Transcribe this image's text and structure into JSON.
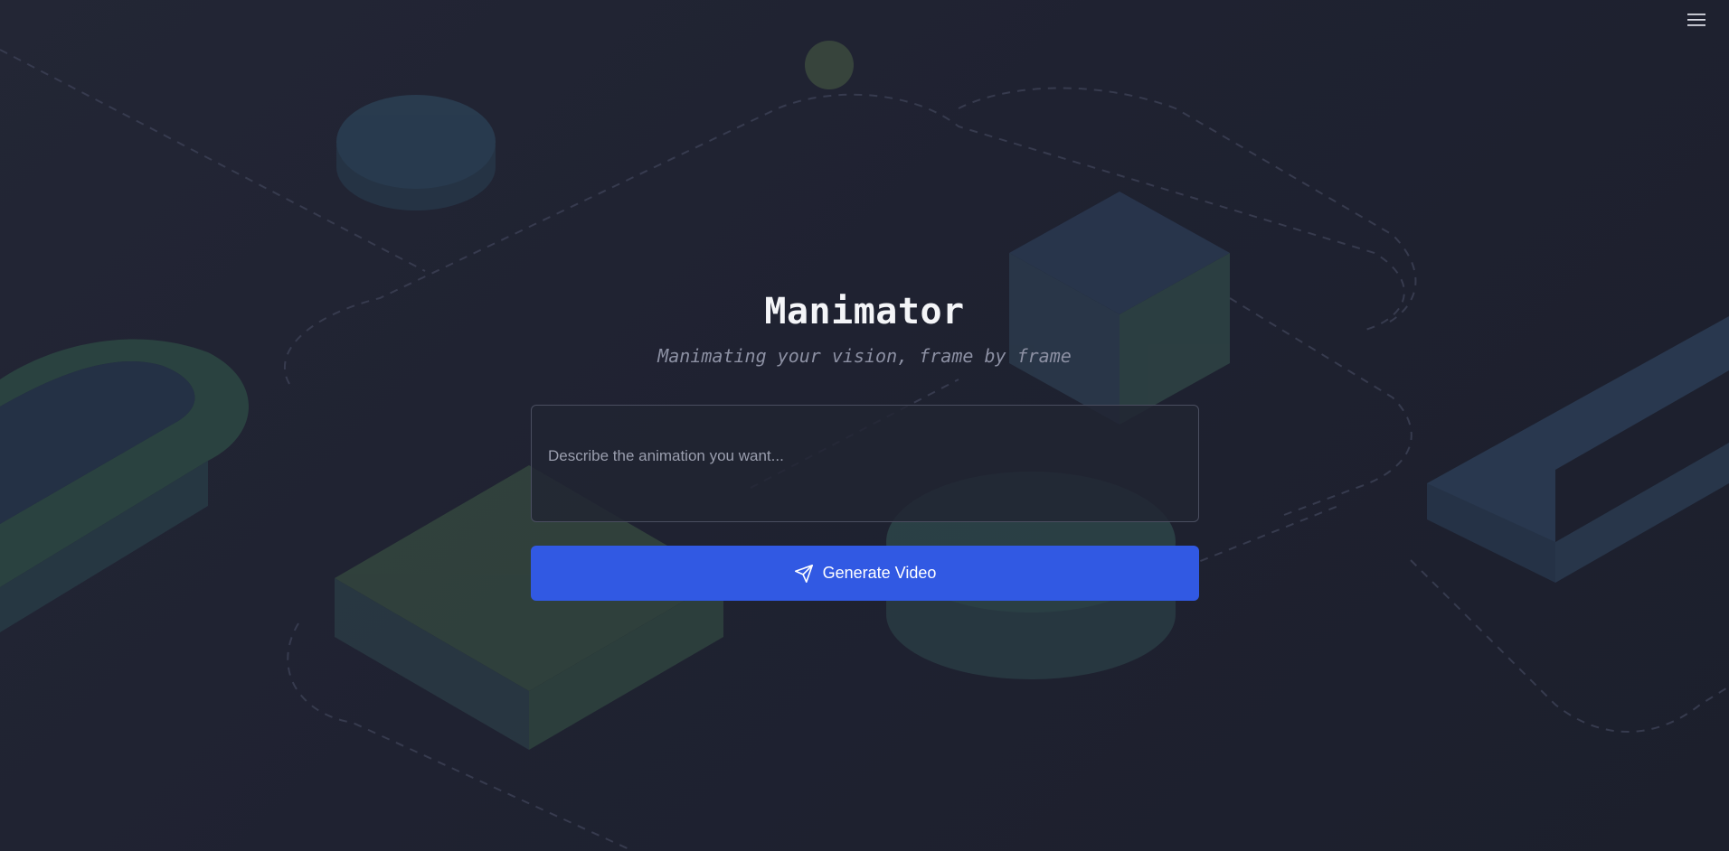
{
  "app": {
    "title": "Manimator",
    "tagline": "Manimating your vision, frame by frame"
  },
  "header": {
    "menu_icon": "hamburger-menu-icon"
  },
  "prompt": {
    "value": "",
    "placeholder": "Describe the animation you want..."
  },
  "actions": {
    "generate_label": "Generate Video",
    "generate_icon": "send-icon"
  },
  "colors": {
    "background": "#1f2230",
    "accent": "#3159e3",
    "title": "#f4f5f8",
    "subtitle": "#8c90a3"
  }
}
